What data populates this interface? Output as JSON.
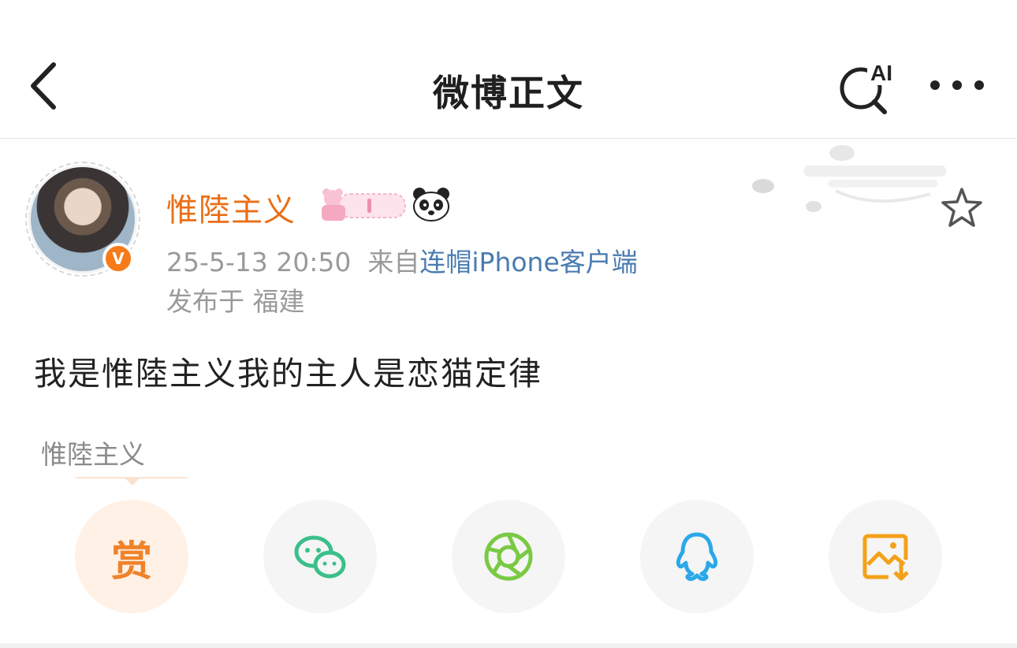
{
  "nav": {
    "title": "微博正文",
    "ai_label": "AI"
  },
  "post": {
    "username": "惟陸主义",
    "timestamp": "25-5-13 20:50",
    "from_label": "来自",
    "source": "连帽iPhone客户端",
    "location": "发布于 福建",
    "verified_mark": "V",
    "text": "我是惟陸主义我的主人是恋猫定律"
  },
  "tip": {
    "label": "惟陸主义"
  },
  "share": {
    "reward_label": "赏"
  },
  "colors": {
    "username": "#eb6e16",
    "source_link": "#4a7bb0",
    "reward": "#f0822a",
    "wechat": "#3bbf8a",
    "moments": "#7ac943",
    "qq": "#2aa8e8",
    "save_image": "#f4a11a"
  },
  "icons": [
    "back-icon",
    "ai-search-icon",
    "more-icon",
    "star-icon",
    "wechat-icon",
    "moments-icon",
    "qq-icon",
    "save-image-icon",
    "panda-icon"
  ]
}
